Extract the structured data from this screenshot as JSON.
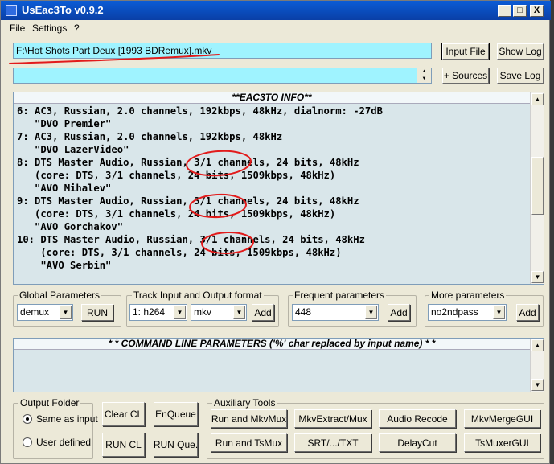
{
  "window": {
    "title": "UsEac3To v0.9.2",
    "controls": [
      "_",
      "□",
      "X"
    ]
  },
  "menu": [
    "File",
    "Settings",
    "?"
  ],
  "input_file_path": "F:\\Hot Shots Part Deux [1993 BDRemux].mkv",
  "secondary_input": "",
  "buttons": {
    "input_file": "Input File",
    "show_log": "Show Log",
    "add_sources": "+ Sources",
    "save_log": "Save Log"
  },
  "info_panel": {
    "header": "**EAC3TO INFO**",
    "lines": [
      "6: AC3, Russian, 2.0 channels, 192kbps, 48kHz, dialnorm: -27dB",
      "   \"DVO Premier\"",
      "7: AC3, Russian, 2.0 channels, 192kbps, 48kHz",
      "   \"DVO LazerVideo\"",
      "8: DTS Master Audio, Russian, 3/1 channels, 24 bits, 48kHz",
      "   (core: DTS, 3/1 channels, 24 bits, 1509kbps, 48kHz)",
      "   \"AVO Mihalev\"",
      "9: DTS Master Audio, Russian, 3/1 channels, 24 bits, 48kHz",
      "   (core: DTS, 3/1 channels, 24 bits, 1509kbps, 48kHz)",
      "   \"AVO Gorchakov\"",
      "10: DTS Master Audio, Russian, 3/1 channels, 24 bits, 48kHz",
      "    (core: DTS, 3/1 channels, 24 bits, 1509kbps, 48kHz)",
      "    \"AVO Serbin\""
    ]
  },
  "global_parameters": {
    "label": "Global Parameters",
    "value": "demux",
    "button": "RUN"
  },
  "track_format": {
    "label": "Track Input and Output format",
    "track": "1: h264",
    "format": "mkv",
    "button": "Add"
  },
  "frequent_parameters": {
    "label": "Frequent parameters",
    "value": "448",
    "button": "Add"
  },
  "more_parameters": {
    "label": "More parameters",
    "value": "no2ndpass",
    "button": "Add"
  },
  "command_line": {
    "header": "* * COMMAND LINE PARAMETERS ('%' char replaced by input name) * *",
    "value": ""
  },
  "output_folder": {
    "label": "Output Folder",
    "options": [
      {
        "label": "Same as input",
        "checked": true
      },
      {
        "label": "User defined",
        "checked": false
      }
    ]
  },
  "cl_buttons": {
    "clear": "Clear CL",
    "run": "RUN CL",
    "enqueue": "EnQueue",
    "run_queue": "RUN Que."
  },
  "auxiliary_tools": {
    "label": "Auxiliary Tools",
    "buttons": [
      "Run and MkvMux",
      "MkvExtract/Mux",
      "Audio Recode",
      "MkvMergeGUI",
      "Run and TsMux",
      "SRT/.../TXT",
      "DelayCut",
      "TsMuxerGUI"
    ]
  },
  "colors": {
    "field": "#9ff3ff",
    "info_bg": "#d9e6ea",
    "window": "#ece9d8",
    "annotation": "#e21b1b"
  }
}
